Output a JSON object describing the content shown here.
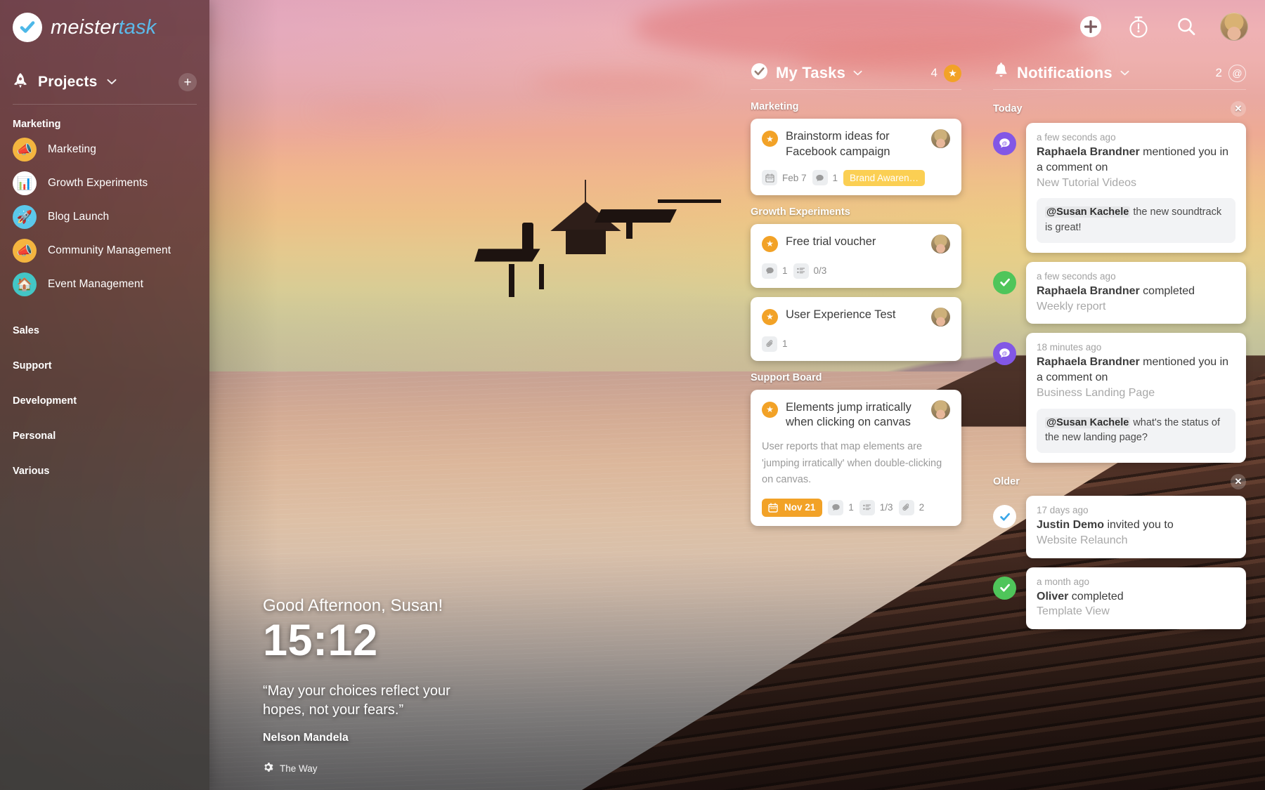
{
  "brand": {
    "name_first": "meister",
    "name_second": "task",
    "check_icon": "check-icon"
  },
  "sidebar": {
    "projects_label": "Projects",
    "chevron_icon": "chevron-down-icon",
    "rocket_icon": "rocket-icon",
    "add_project_label": "+",
    "groups": [
      {
        "label": "Marketing",
        "projects": [
          {
            "name": "Marketing",
            "icon": "megaphone-icon",
            "glyph": "📣",
            "color": "#f4b53f"
          },
          {
            "name": "Growth Experiments",
            "icon": "bar-chart-icon",
            "glyph": "📊",
            "color": "#ffffff"
          },
          {
            "name": "Blog Launch",
            "icon": "rocket-icon",
            "glyph": "🚀",
            "color": "#5bc8ea"
          },
          {
            "name": "Community Management",
            "icon": "megaphone-icon",
            "glyph": "📣",
            "color": "#f4b53f"
          },
          {
            "name": "Event Management",
            "icon": "house-icon",
            "glyph": "🏠",
            "color": "#43c6c6"
          }
        ]
      },
      {
        "label": "Sales",
        "projects": []
      },
      {
        "label": "Support",
        "projects": []
      },
      {
        "label": "Development",
        "projects": []
      },
      {
        "label": "Personal",
        "projects": []
      },
      {
        "label": "Various",
        "projects": []
      }
    ]
  },
  "toolbar": {
    "items": [
      {
        "name": "add-button",
        "icon": "plus-circle-icon"
      },
      {
        "name": "timer-button",
        "icon": "stopwatch-icon"
      },
      {
        "name": "search-button",
        "icon": "search-icon"
      },
      {
        "name": "profile-avatar",
        "icon": "avatar-icon"
      }
    ]
  },
  "my_tasks": {
    "title": "My Tasks",
    "chevron_icon": "chevron-down-icon",
    "check_icon": "check-circle-icon",
    "count": "4",
    "star_icon": "star-icon",
    "sections": [
      {
        "label": "Marketing",
        "cards": [
          {
            "title": "Brainstorm ideas for Facebook campaign",
            "description": "",
            "date": "Feb 7",
            "date_highlight": false,
            "comments": "1",
            "checklist": "",
            "attachments": "",
            "tag": "Brand Awaren…"
          }
        ]
      },
      {
        "label": "Growth Experiments",
        "cards": [
          {
            "title": "Free trial voucher",
            "description": "",
            "date": "",
            "date_highlight": false,
            "comments": "1",
            "checklist": "0/3",
            "attachments": "",
            "tag": ""
          },
          {
            "title": "User Experience Test",
            "description": "",
            "date": "",
            "date_highlight": false,
            "comments": "",
            "checklist": "",
            "attachments": "1",
            "tag": ""
          }
        ]
      },
      {
        "label": "Support Board",
        "cards": [
          {
            "title": "Elements jump irratically when clicking on canvas",
            "description": "User reports that map elements are 'jumping irratically' when double-clicking on canvas.",
            "date": "Nov 21",
            "date_highlight": true,
            "comments": "1",
            "checklist": "1/3",
            "attachments": "2",
            "tag": ""
          }
        ]
      }
    ]
  },
  "notifications": {
    "title": "Notifications",
    "bell_icon": "bell-icon",
    "chevron_icon": "chevron-down-icon",
    "count": "2",
    "at_icon": "at-icon",
    "groups": [
      {
        "label": "Today",
        "close_icon": "close-icon",
        "items": [
          {
            "icon": "mention-icon",
            "icon_kind": "mention",
            "time": "a few seconds ago",
            "actor": "Raphaela Brandner",
            "action": " mentioned you in a comment on",
            "object": "New Tutorial Videos",
            "quote_mention": "@Susan Kachele",
            "quote_text": " the new soundtrack is great!"
          },
          {
            "icon": "check-icon",
            "icon_kind": "done",
            "time": "a few seconds ago",
            "actor": "Raphaela Brandner",
            "action": " completed",
            "object": "Weekly report",
            "quote_mention": "",
            "quote_text": ""
          },
          {
            "icon": "mention-icon",
            "icon_kind": "mention",
            "time": "18 minutes ago",
            "actor": "Raphaela Brandner",
            "action": " mentioned you in a comment on",
            "object": "Business Landing Page",
            "quote_mention": "@Susan Kachele",
            "quote_text": " what's the status of the new landing page?"
          }
        ]
      },
      {
        "label": "Older",
        "close_icon": "close-icon",
        "items": [
          {
            "icon": "check-icon",
            "icon_kind": "invite",
            "time": "17 days ago",
            "actor": "Justin Demo",
            "action": " invited you to",
            "object": "Website Relaunch",
            "quote_mention": "",
            "quote_text": ""
          },
          {
            "icon": "check-icon",
            "icon_kind": "done",
            "time": "a month ago",
            "actor": "Oliver",
            "action": " completed",
            "object": "Template View",
            "quote_mention": "",
            "quote_text": ""
          }
        ]
      }
    ]
  },
  "greeting": {
    "salutation": "Good Afternoon, Susan!",
    "clock": "15:12",
    "quote": "“May your choices reflect your hopes, not your fears.”",
    "author": "Nelson Mandela",
    "theme_name": "The Way",
    "theme_icon": "gear-icon"
  },
  "colors": {
    "accent_orange": "#f2a227",
    "tag_yellow": "#fbcf53",
    "mention_purple": "#8257e6",
    "done_green": "#4fc55a",
    "brand_blue": "#5bbaea"
  }
}
